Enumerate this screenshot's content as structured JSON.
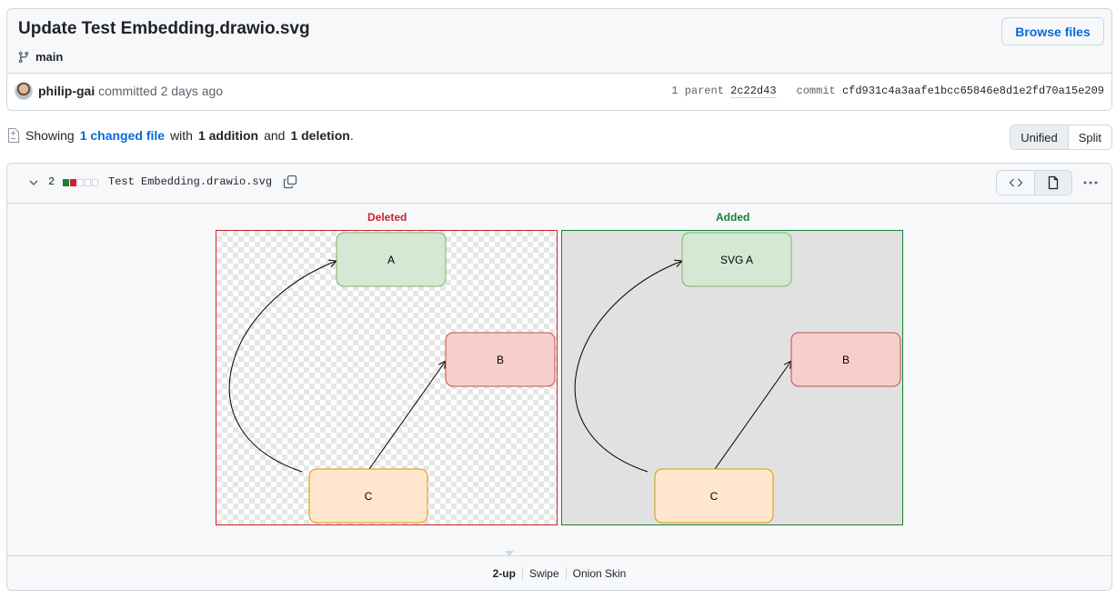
{
  "commit": {
    "title": "Update Test Embedding.drawio.svg",
    "branch": "main",
    "browse_label": "Browse files",
    "author": "philip-gai",
    "committed_text": "committed 2 days ago",
    "parent_label": "1 parent",
    "parent_sha": "2c22d43",
    "commit_label": "commit",
    "commit_sha": "cfd931c4a3aafe1bcc65846e8d1e2fd70a15e209"
  },
  "summary": {
    "showing": "Showing",
    "changed_link": "1 changed file",
    "with": "with",
    "additions": "1 addition",
    "and": "and",
    "deletions": "1 deletion",
    "period": ".",
    "view_unified": "Unified",
    "view_split": "Split"
  },
  "file": {
    "change_count": "2",
    "name": "Test Embedding.drawio.svg",
    "diffstat": [
      "#1a7f37",
      "#cf222e",
      "#d0d7de",
      "#d0d7de",
      "#d0d7de"
    ],
    "label_deleted": "Deleted",
    "label_added": "Added",
    "deleted_diagram": {
      "a": "A",
      "b": "B",
      "c": "C"
    },
    "added_diagram": {
      "a": "SVG A",
      "b": "B",
      "c": "C"
    },
    "modes": [
      "2-up",
      "Swipe",
      "Onion Skin"
    ],
    "active_mode": "2-up"
  },
  "colors": {
    "node_a_fill": "#d5e8d4",
    "node_a_stroke": "#82b366",
    "node_b_fill": "#f8cecc",
    "node_b_stroke": "#b85450",
    "node_c_fill": "#ffe6cc",
    "node_c_stroke": "#d79b00"
  }
}
